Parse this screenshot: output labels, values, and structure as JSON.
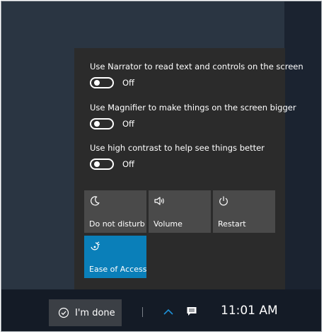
{
  "options": [
    {
      "label": "Use Narrator to read text and controls on the screen",
      "state": "Off"
    },
    {
      "label": "Use Magnifier to make things on the screen bigger",
      "state": "Off"
    },
    {
      "label": "Use high contrast to help see things better",
      "state": "Off"
    }
  ],
  "tiles": [
    {
      "label": "Do not disturb",
      "icon": "moon-icon"
    },
    {
      "label": "Volume",
      "icon": "speaker-icon"
    },
    {
      "label": "Restart",
      "icon": "power-icon"
    },
    {
      "label": "Ease of Access",
      "icon": "ease-of-access-icon"
    }
  ],
  "taskbar": {
    "done_label": "I'm done",
    "time": "11:01 AM"
  },
  "colors": {
    "accent": "#0a7fb9",
    "tile": "#4a4a4a",
    "flyout": "#2b2b2b",
    "taskbar": "#141b26"
  }
}
